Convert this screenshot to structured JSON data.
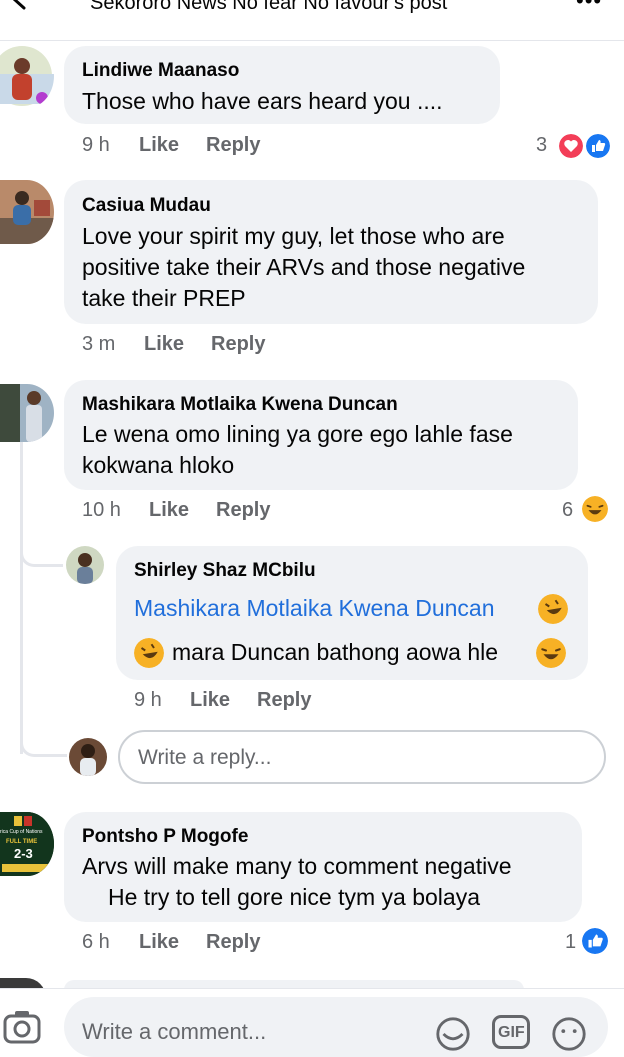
{
  "header": {
    "title": "Sekororo News No fear No favour's post"
  },
  "comments": [
    {
      "author": "Lindiwe Maanaso",
      "lines": [
        "Those who have ears heard you ...."
      ],
      "time": "9 h",
      "like_label": "Like",
      "reply_label": "Reply",
      "reaction_count": "3",
      "reactions": [
        "love-icon",
        "like-icon"
      ]
    },
    {
      "author": "Casiua Mudau",
      "lines": [
        "Love your spirit my guy, let those who are",
        "positive take their ARVs and those negative",
        "take their PREP"
      ],
      "time": "3 m",
      "like_label": "Like",
      "reply_label": "Reply"
    },
    {
      "author": "Mashikara Motlaika Kwena Duncan",
      "lines": [
        "Le wena omo lining ya gore ego lahle fase",
        "kokwana hloko"
      ],
      "time": "10 h",
      "like_label": "Like",
      "reply_label": "Reply",
      "reaction_count": "6",
      "reactions": [
        "laughing-emoji-icon"
      ]
    },
    {
      "author": "Pontsho P Mogofe",
      "lines": [
        "Arvs will make many to comment negative",
        "He try to tell gore nice tym ya bolaya"
      ],
      "time": "6 h",
      "like_label": "Like",
      "reply_label": "Reply",
      "reaction_count": "1",
      "reactions": [
        "like-icon"
      ]
    }
  ],
  "reply": {
    "author": "Shirley Shaz MCbilu",
    "mention": "Mashikara Motlaika Kwena Duncan",
    "line2": "mara Duncan bathong aowa hle",
    "time": "9 h",
    "like_label": "Like",
    "reply_label": "Reply"
  },
  "reply_input": {
    "placeholder": "Write a reply..."
  },
  "avatar_badge": {
    "title": "rica Cup of Nations",
    "status": "FULL TIME",
    "score": "2-3"
  },
  "bottom_bar": {
    "placeholder": "Write a comment...",
    "gif_label": "GIF"
  },
  "colors": {
    "bubble": "#f0f2f5",
    "mention": "#216fdb",
    "meta": "#65676b",
    "love": "#f33e58",
    "like": "#1877f2",
    "emoji": "#f7b125"
  }
}
